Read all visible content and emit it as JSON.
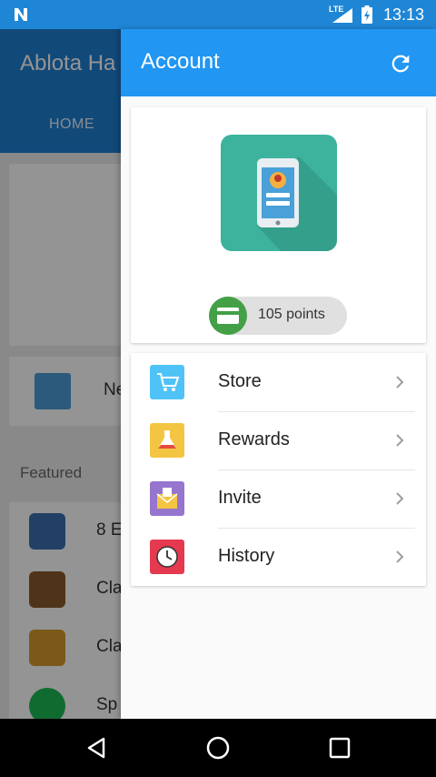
{
  "status_bar": {
    "network": "LTE",
    "time": "13:13"
  },
  "background_app": {
    "title": "Ablota Ha",
    "tab": "HOME",
    "news_label": "Ne",
    "featured_label": "Featured",
    "featured_items": [
      {
        "label": "8 E",
        "icon": "8-ball-pool-icon",
        "color": "#3b6fb0"
      },
      {
        "label": "Cla",
        "icon": "clash-royale-icon",
        "color": "#8a5a2b"
      },
      {
        "label": "Cla",
        "icon": "clash-of-clans-icon",
        "color": "#d69a2d"
      },
      {
        "label": "Sp",
        "icon": "spotify-icon",
        "color": "#1db954"
      }
    ]
  },
  "drawer": {
    "title": "Account",
    "points": "105 points",
    "menu": [
      {
        "label": "Store",
        "icon": "cart-icon",
        "color": "#4fc3f7"
      },
      {
        "label": "Rewards",
        "icon": "flask-icon",
        "color": "#f4c542"
      },
      {
        "label": "Invite",
        "icon": "envelope-icon",
        "color": "#9575cd"
      },
      {
        "label": "History",
        "icon": "clock-icon",
        "color": "#e53950"
      }
    ]
  },
  "colors": {
    "primary": "#2196f3",
    "points_green": "#43a047",
    "app_icon_teal": "#3db39e"
  }
}
